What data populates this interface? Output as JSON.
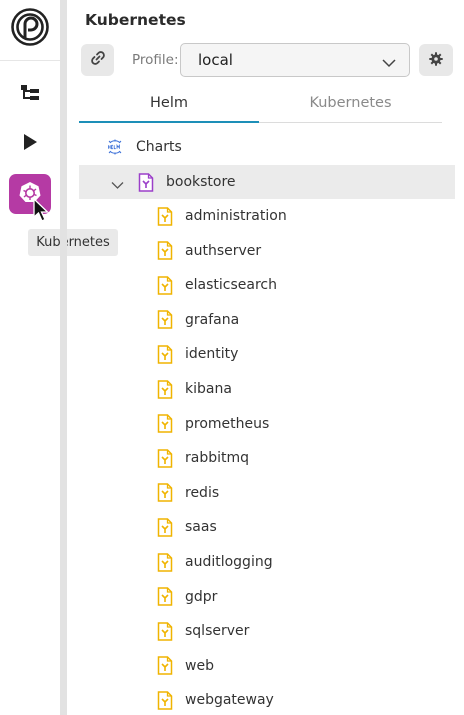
{
  "activity_bar": {
    "tooltip": "Kubernetes",
    "icons": [
      "app-logo-icon",
      "explorer-icon",
      "run-icon",
      "kubernetes-icon"
    ]
  },
  "panel": {
    "title": "Kubernetes",
    "profile_label": "Profile:",
    "profile_value": "local",
    "tabs": [
      {
        "label": "Helm",
        "active": true
      },
      {
        "label": "Kubernetes",
        "active": false
      }
    ]
  },
  "tree": {
    "root_label": "Charts",
    "chart": "bookstore",
    "items": [
      "administration",
      "authserver",
      "elasticsearch",
      "grafana",
      "identity",
      "kibana",
      "prometheus",
      "rabbitmq",
      "redis",
      "saas",
      "auditlogging",
      "gdpr",
      "sqlserver",
      "web",
      "webgateway"
    ]
  },
  "colors": {
    "accent_tab": "#1d8fb8",
    "kubernetes_active": "#b53aa4",
    "file_icon": "#f0b400",
    "folder_icon": "#9b3fc9",
    "helm_icon": "#3a6fd8"
  }
}
